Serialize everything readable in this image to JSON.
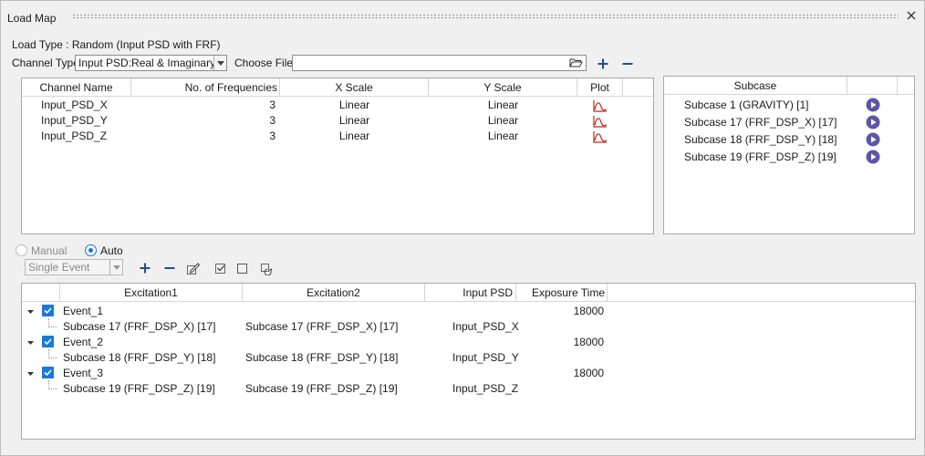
{
  "window": {
    "title": "Load Map"
  },
  "header": {
    "load_type": "Load Type : Random (Input PSD with FRF)",
    "channel_type_label": "Channel Type",
    "channel_type_value": "Input PSD:Real & Imaginary",
    "choose_file_label": "Choose File",
    "choose_file_value": ""
  },
  "channels": {
    "columns": [
      "Channel Name",
      "No. of Frequencies",
      "X Scale",
      "Y Scale",
      "Plot"
    ],
    "rows": [
      {
        "name": "Input_PSD_X",
        "freqs": "3",
        "xscale": "Linear",
        "yscale": "Linear"
      },
      {
        "name": "Input_PSD_Y",
        "freqs": "3",
        "xscale": "Linear",
        "yscale": "Linear"
      },
      {
        "name": "Input_PSD_Z",
        "freqs": "3",
        "xscale": "Linear",
        "yscale": "Linear"
      }
    ]
  },
  "subcases": {
    "column": "Subcase",
    "rows": [
      "Subcase 1 (GRAVITY) [1]",
      "Subcase 17 (FRF_DSP_X) [17]",
      "Subcase 18 (FRF_DSP_Y) [18]",
      "Subcase 19 (FRF_DSP_Z) [19]"
    ]
  },
  "mode": {
    "manual": "Manual",
    "auto": "Auto",
    "selected": "Auto"
  },
  "event_type": {
    "value": "Single Event"
  },
  "events": {
    "columns": [
      "Excitation1",
      "Excitation2",
      "Input PSD",
      "Exposure Time"
    ],
    "items": [
      {
        "name": "Event_1",
        "exposure": "18000",
        "exc1": "Subcase 17 (FRF_DSP_X) [17]",
        "exc2": "Subcase 17 (FRF_DSP_X) [17]",
        "psd": "Input_PSD_X"
      },
      {
        "name": "Event_2",
        "exposure": "18000",
        "exc1": "Subcase 18 (FRF_DSP_Y) [18]",
        "exc2": "Subcase 18 (FRF_DSP_Y) [18]",
        "psd": "Input_PSD_Y"
      },
      {
        "name": "Event_3",
        "exposure": "18000",
        "exc1": "Subcase 19 (FRF_DSP_Z) [19]",
        "exc2": "Subcase 19 (FRF_DSP_Z) [19]",
        "psd": "Input_PSD_Z"
      }
    ]
  },
  "colors": {
    "accent": "#1a73d9",
    "play": "#5a57a8",
    "plot_icon": "#c0281e"
  }
}
